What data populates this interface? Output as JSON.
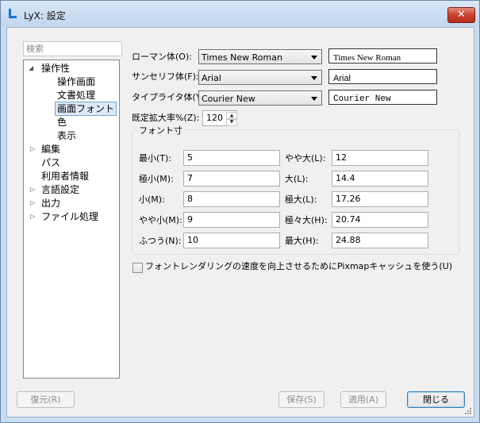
{
  "window": {
    "title": "LyX: 設定",
    "close_glyph": "✕"
  },
  "search": {
    "placeholder": "検索"
  },
  "tree": {
    "items": [
      {
        "label": "操作性",
        "expanded": true
      },
      {
        "label": "操作画面"
      },
      {
        "label": "文書処理"
      },
      {
        "label": "画面フォント",
        "selected": true
      },
      {
        "label": "色"
      },
      {
        "label": "表示"
      },
      {
        "label": "編集",
        "expandable": true
      },
      {
        "label": "パス"
      },
      {
        "label": "利用者情報"
      },
      {
        "label": "言語設定",
        "expandable": true
      },
      {
        "label": "出力",
        "expandable": true
      },
      {
        "label": "ファイル処理",
        "expandable": true
      }
    ]
  },
  "fonts": {
    "roman_label": "ローマン体(O):",
    "roman_value": "Times New Roman",
    "roman_preview": "Times New Roman",
    "sans_label": "サンセリフ体(F):",
    "sans_value": "Arial",
    "sans_preview": "Arial",
    "typewriter_label": "タイプライタ体(Y):",
    "typewriter_value": "Courier New",
    "typewriter_preview": "Courier New",
    "zoom_label": "既定拡大率%(Z):",
    "zoom_value": "120"
  },
  "sizes": {
    "group_title": "フォント寸",
    "left": [
      {
        "label": "最小(T):",
        "value": "5"
      },
      {
        "label": "極小(M):",
        "value": "7"
      },
      {
        "label": "小(M):",
        "value": "8"
      },
      {
        "label": "やや小(M):",
        "value": "9"
      },
      {
        "label": "ふつう(N):",
        "value": "10"
      }
    ],
    "right": [
      {
        "label": "やや大(L):",
        "value": "12"
      },
      {
        "label": "大(L):",
        "value": "14.4"
      },
      {
        "label": "極大(L):",
        "value": "17.26"
      },
      {
        "label": "極々大(H):",
        "value": "20.74"
      },
      {
        "label": "最大(H):",
        "value": "24.88"
      }
    ]
  },
  "pixmap": {
    "label": "フォントレンダリングの速度を向上させるためにPixmapキャッシュを使う(U)",
    "checked": false
  },
  "buttons": {
    "restore": "復元(R)",
    "save": "保存(S)",
    "apply": "適用(A)",
    "close": "閉じる"
  },
  "colors": {
    "accent": "#1874d2",
    "close_red": "#c8412e",
    "selection": "#dce9f8"
  }
}
